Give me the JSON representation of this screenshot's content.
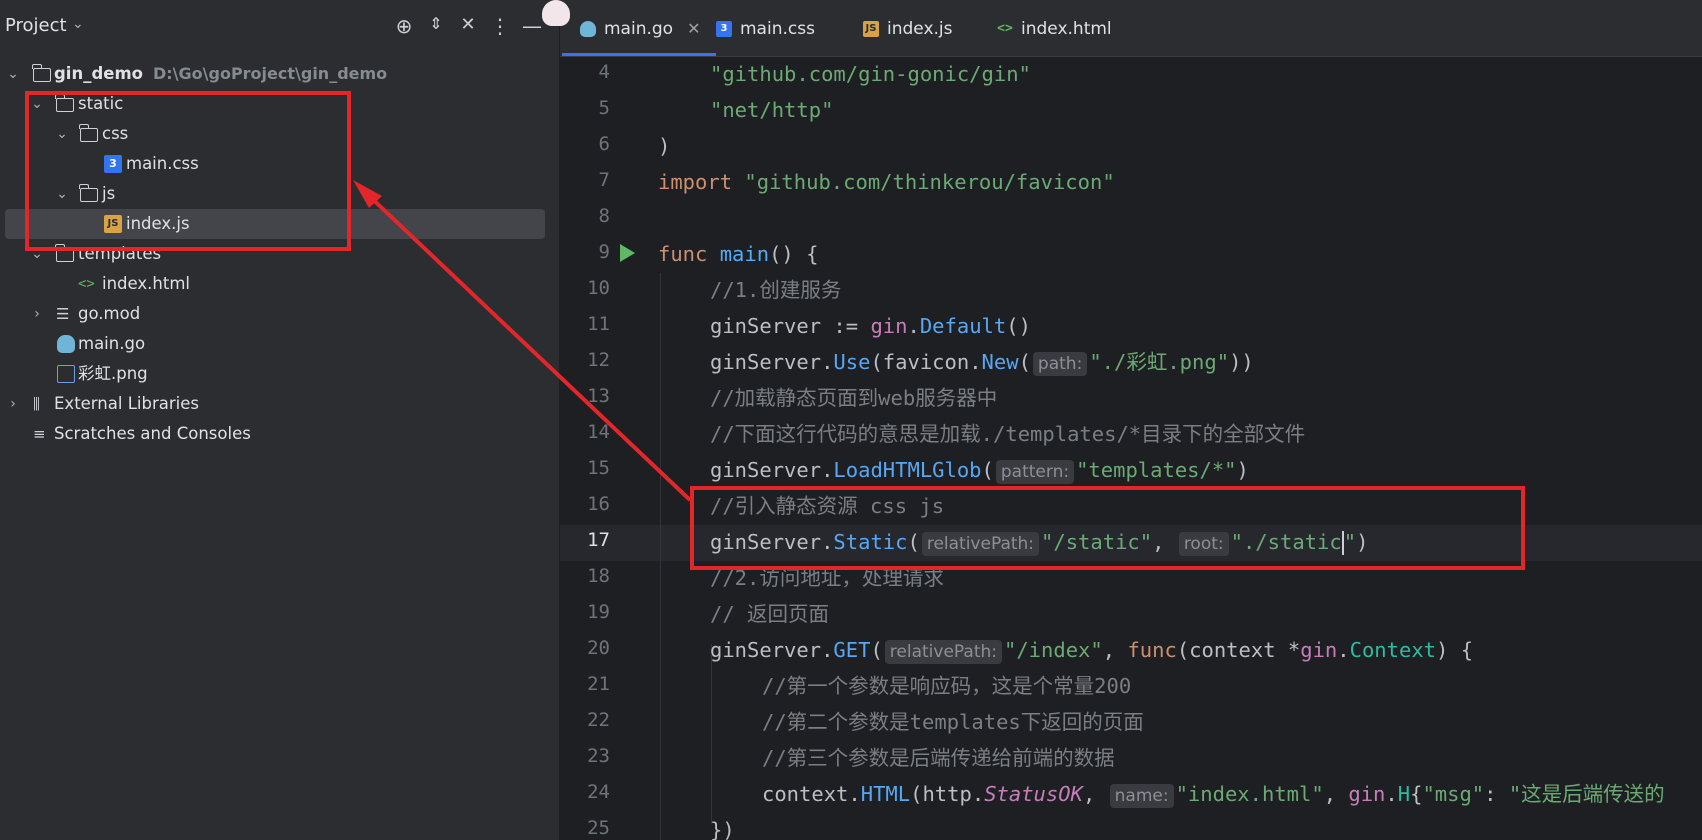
{
  "project_panel": {
    "title": "Project",
    "icons": [
      "crosshair-icon",
      "expand-collapse-icon",
      "collapse-all-icon",
      "more-vertical-icon",
      "minimize-icon"
    ],
    "tree": [
      {
        "label": "gin_demo",
        "path": "D:\\Go\\goProject\\gin_demo",
        "type": "folder",
        "expanded": true
      },
      {
        "label": "static",
        "type": "folder",
        "expanded": true
      },
      {
        "label": "css",
        "type": "folder",
        "expanded": true
      },
      {
        "label": "main.css",
        "type": "css"
      },
      {
        "label": "js",
        "type": "folder",
        "expanded": true
      },
      {
        "label": "index.js",
        "type": "js",
        "selected": true
      },
      {
        "label": "templates",
        "type": "folder",
        "expanded": true
      },
      {
        "label": "index.html",
        "type": "html"
      },
      {
        "label": "go.mod",
        "type": "mod",
        "expanded": false
      },
      {
        "label": "main.go",
        "type": "go"
      },
      {
        "label": "彩虹.png",
        "type": "png"
      },
      {
        "label": "External Libraries",
        "type": "library",
        "expanded": false
      },
      {
        "label": "Scratches and Consoles",
        "type": "scratches"
      }
    ]
  },
  "tabs": [
    {
      "label": "main.go",
      "icon": "go-file-icon",
      "active": true,
      "closable": true
    },
    {
      "label": "main.css",
      "icon": "css-file-icon",
      "active": false
    },
    {
      "label": "index.js",
      "icon": "js-file-icon",
      "active": false
    },
    {
      "label": "index.html",
      "icon": "html-file-icon",
      "active": false
    }
  ],
  "editor": {
    "current_line": "17",
    "line_numbers": [
      "4",
      "5",
      "6",
      "7",
      "8",
      "9",
      "10",
      "11",
      "12",
      "13",
      "14",
      "15",
      "16",
      "17",
      "18",
      "19",
      "20",
      "21",
      "22",
      "23",
      "24",
      "25"
    ],
    "lines": {
      "l4": "\"github.com/gin-gonic/gin\"",
      "l5": "\"net/http\"",
      "l6": ")",
      "l7_kw": "import",
      "l7_str": "\"github.com/thinkerou/favicon\"",
      "l9_kw": "func",
      "l9_fn": "main",
      "l9_rest": "() {",
      "l10": "//1.创建服务",
      "l11_a": "ginServer := ",
      "l11_b": "gin",
      "l11_c": ".",
      "l11_d": "Default",
      "l11_e": "()",
      "l12_a": "ginServer.",
      "l12_b": "Use",
      "l12_c": "(favicon.",
      "l12_d": "New",
      "l12_e": "(",
      "l12_hint": "path:",
      "l12_str": "\"./彩虹.png\"",
      "l12_f": "))",
      "l13": "//加载静态页面到web服务器中",
      "l14": "//下面这行代码的意思是加载./templates/*目录下的全部文件",
      "l15_a": "ginServer.",
      "l15_b": "LoadHTMLGlob",
      "l15_c": "(",
      "l15_hint": "pattern:",
      "l15_str": "\"templates/*\"",
      "l15_d": ")",
      "l16": "//引入静态资源 css js",
      "l17_a": "ginServer.",
      "l17_b": "Static",
      "l17_c": "(",
      "l17_hint1": "relativePath:",
      "l17_str1": "\"/static\"",
      "l17_d": ", ",
      "l17_hint2": "root:",
      "l17_str2a": "\"./static",
      "l17_str2b": "\"",
      "l17_e": ")",
      "l18": "//2.访问地址，处理请求",
      "l19": "// 返回页面",
      "l20_a": "ginServer.",
      "l20_b": "GET",
      "l20_c": "(",
      "l20_hint": "relativePath:",
      "l20_str": "\"/index\"",
      "l20_d": ", ",
      "l20_kw": "func",
      "l20_e": "(context *",
      "l20_f": "gin",
      "l20_g": ".",
      "l20_h": "Context",
      "l20_i": ") {",
      "l21": "//第一个参数是响应码，这是个常量200",
      "l22": "//第二个参数是templates下返回的页面",
      "l23": "//第三个参数是后端传递给前端的数据",
      "l24_a": "context.",
      "l24_b": "HTML",
      "l24_c": "(http.",
      "l24_d": "StatusOK",
      "l24_e": ", ",
      "l24_hint": "name:",
      "l24_str": "\"index.html\"",
      "l24_f": ", ",
      "l24_g": "gin",
      "l24_h": ".",
      "l24_i": "H",
      "l24_j": "{",
      "l24_str2": "\"msg\"",
      "l24_k": ": ",
      "l24_str3": "\"这是后端传送的",
      "l25": "})"
    }
  },
  "colors": {
    "annotation_red": "#e2262a",
    "accent_blue": "#3574f0"
  }
}
